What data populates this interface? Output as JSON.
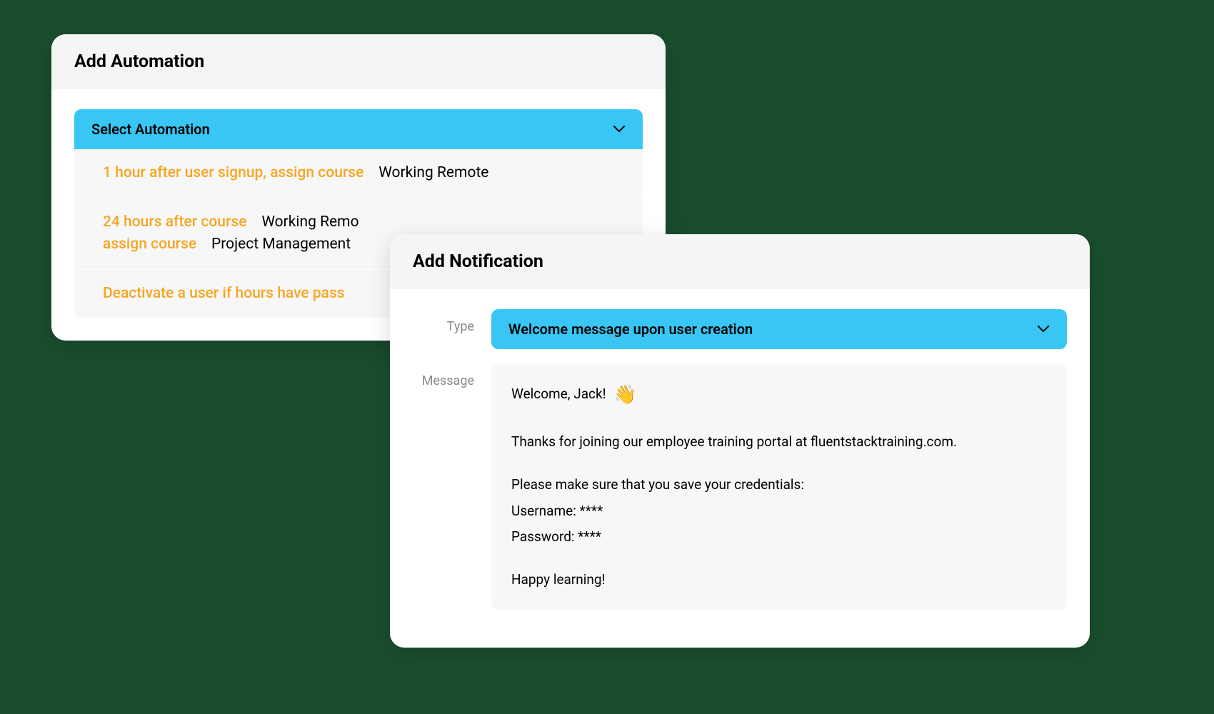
{
  "automation": {
    "title": "Add Automation",
    "select_label": "Select Automation",
    "options": [
      {
        "kw1": "1 hour after user signup, assign course",
        "v1": "Working Remote"
      },
      {
        "kw1": "24 hours after course",
        "v1": "Working Remo",
        "kw2": "assign course",
        "v2": "Project Management "
      },
      {
        "kw1": "Deactivate a user if",
        "kw2": "hours have pass"
      }
    ]
  },
  "notification": {
    "title": "Add Notification",
    "type_label": "Type",
    "type_value": "Welcome message upon user creation",
    "message_label": "Message",
    "message": {
      "greeting": "Welcome, Jack!",
      "thanks": "Thanks for joining our employee training portal at fluentstacktraining.com.",
      "creds_intro": "Please make sure that you save your credentials:",
      "username": "Username: ****",
      "password": "Password: ****",
      "signoff": "Happy learning!"
    }
  }
}
